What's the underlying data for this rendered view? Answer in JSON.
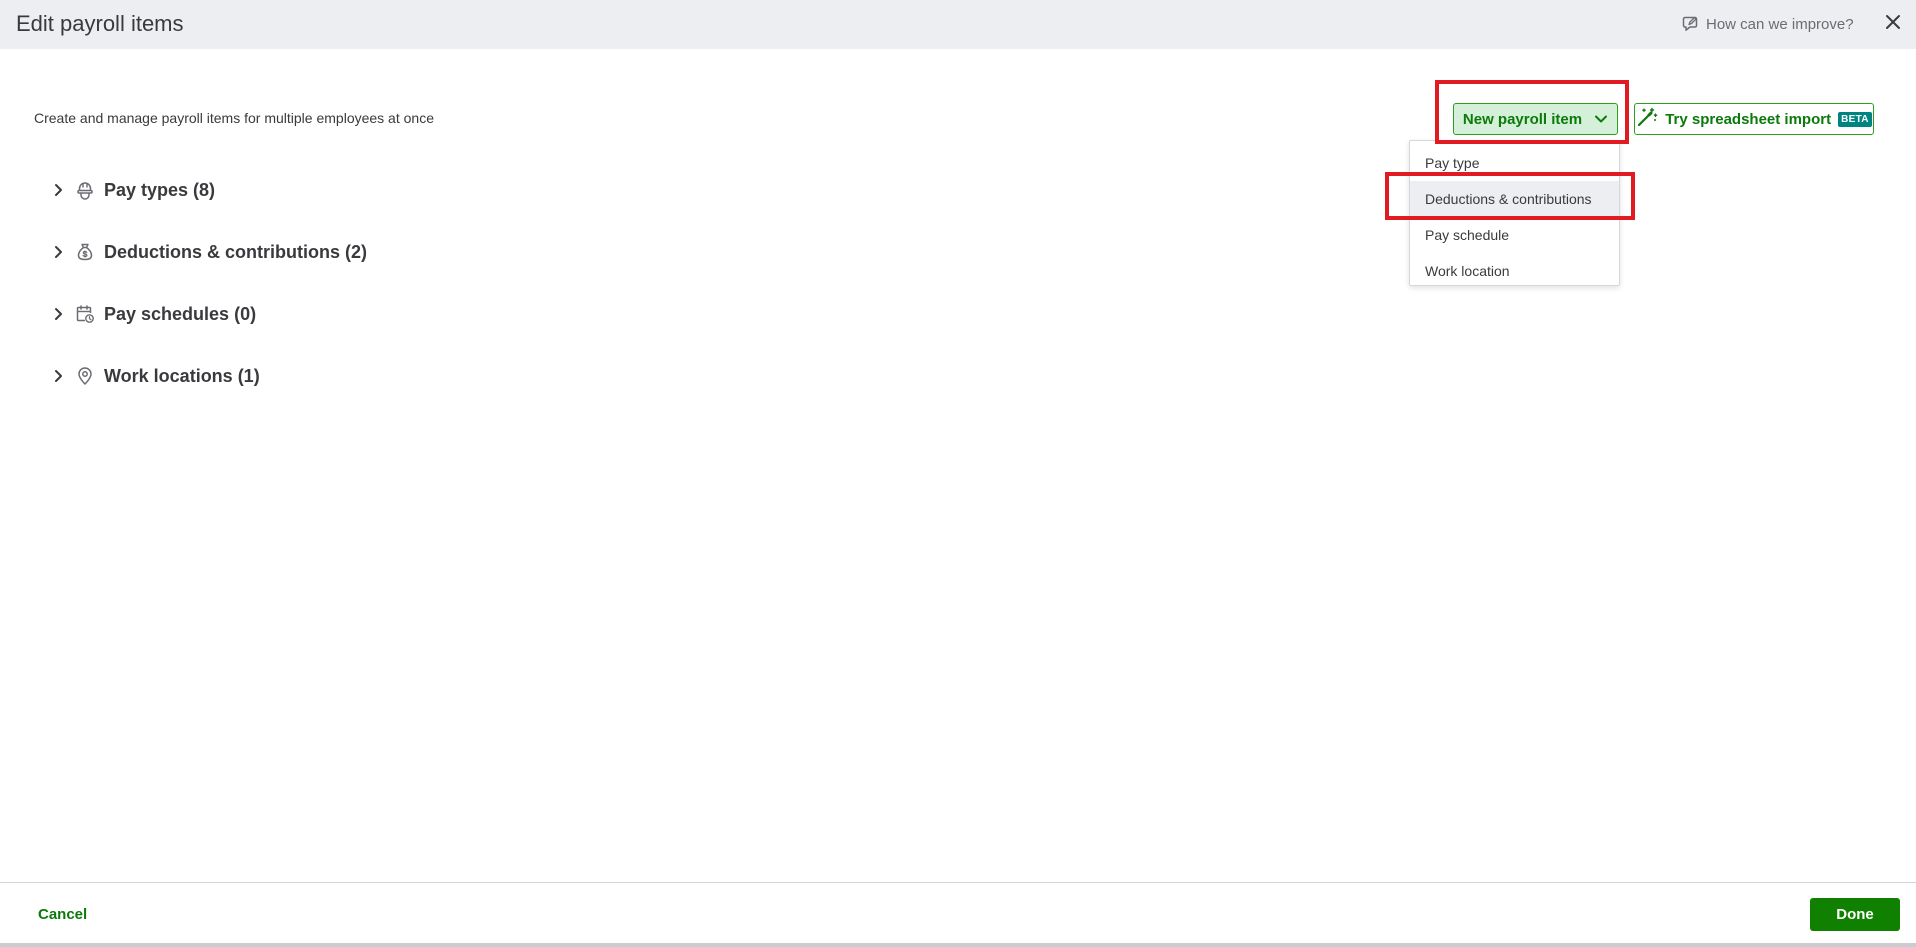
{
  "header": {
    "title": "Edit payroll items",
    "feedback_label": "How can we improve?"
  },
  "toolbar": {
    "subtitle": "Create and manage payroll items for multiple employees at once",
    "new_item_label": "New payroll item",
    "import_label": "Try spreadsheet import",
    "beta_badge": "BETA"
  },
  "menu": {
    "items": [
      {
        "label": "Pay type"
      },
      {
        "label": "Deductions & contributions",
        "hovered": true
      },
      {
        "label": "Pay schedule"
      },
      {
        "label": "Work location"
      }
    ]
  },
  "sections": [
    {
      "label": "Pay types (8)",
      "icon": "hard-hat-icon"
    },
    {
      "label": "Deductions & contributions (2)",
      "icon": "money-bag-icon"
    },
    {
      "label": "Pay schedules (0)",
      "icon": "calendar-clock-icon"
    },
    {
      "label": "Work locations (1)",
      "icon": "location-pin-icon"
    }
  ],
  "footer": {
    "cancel_label": "Cancel",
    "done_label": "Done"
  },
  "colors": {
    "brand_green": "#2ca01c",
    "dark_green": "#108000",
    "annotation_red": "#e21b23",
    "beta_teal": "#008481"
  }
}
